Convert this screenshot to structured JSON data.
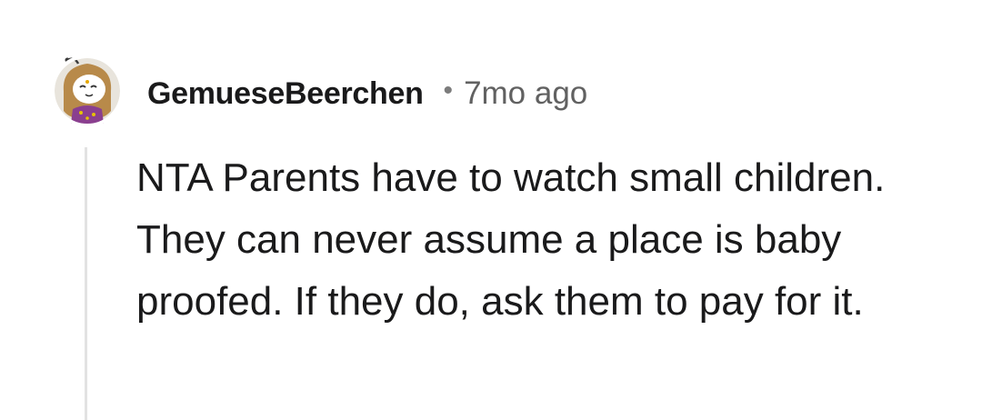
{
  "comment": {
    "author": "GemueseBeerchen",
    "separator": "•",
    "age": "7mo ago",
    "body": "NTA Parents have to watch small children. They can never assume a place is baby proofed. If they do, ask them to pay for it."
  },
  "icons": {
    "avatar": "user-avatar-icon"
  },
  "colors": {
    "text": "#1a1a1b",
    "timestamp": "#616161",
    "thread_line": "#e2e2e2"
  }
}
